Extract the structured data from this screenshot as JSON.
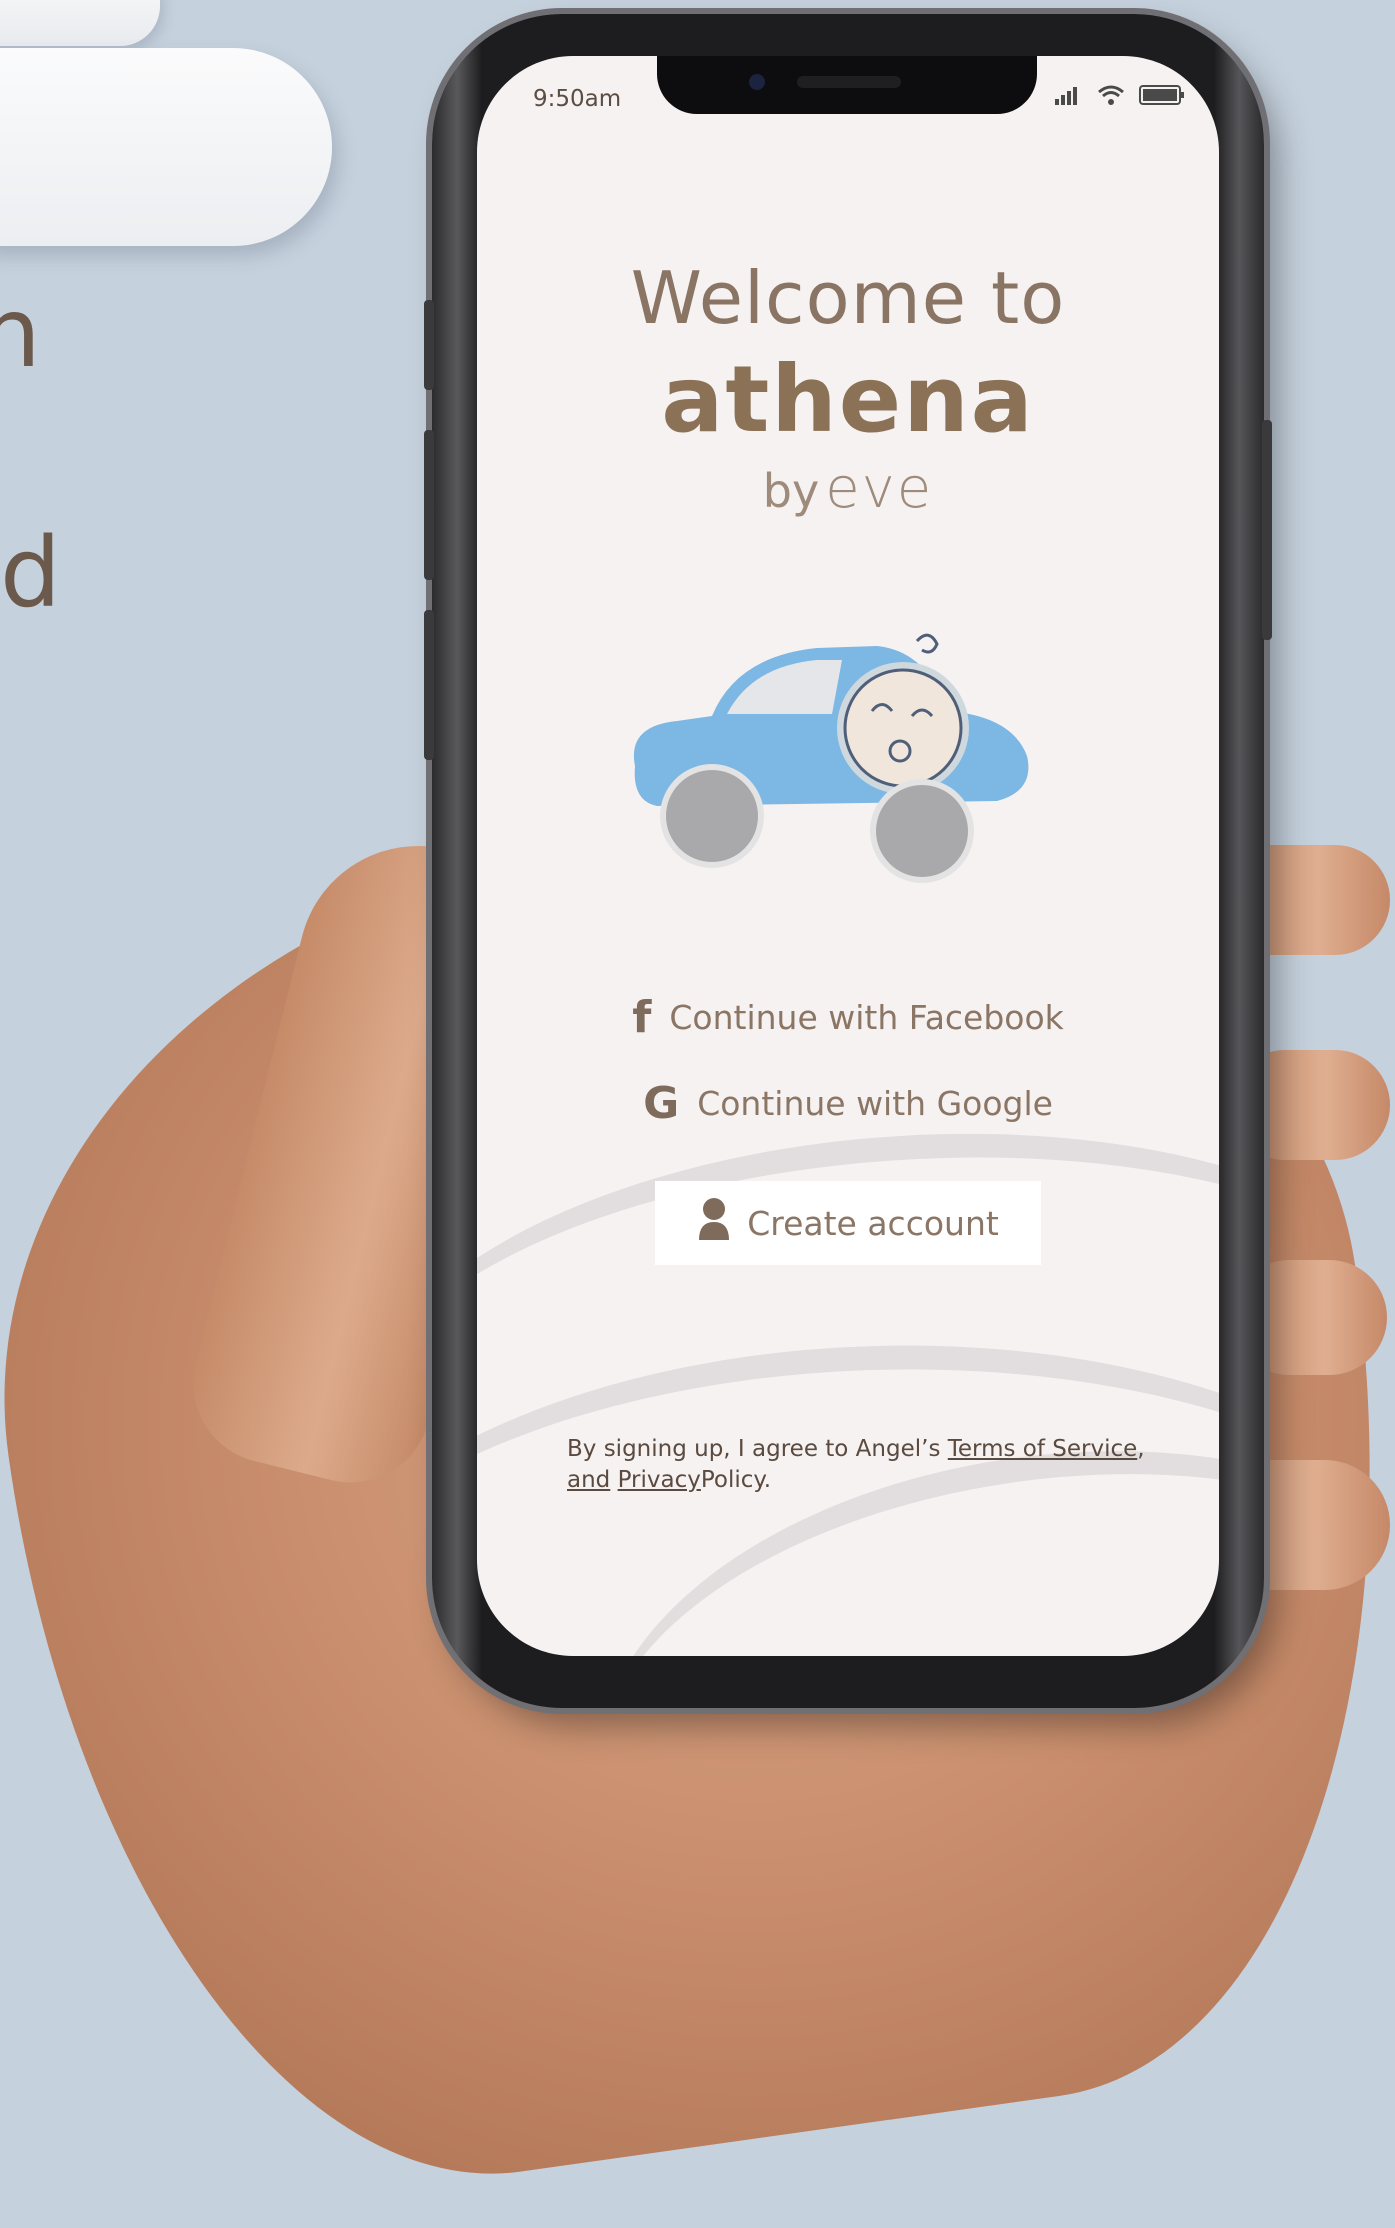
{
  "background": {
    "letters": [
      "n",
      "d"
    ]
  },
  "status_bar": {
    "time": "9:50am"
  },
  "welcome": {
    "line1": "Welcome to",
    "brand": "athena",
    "by": "by",
    "eve": "eve"
  },
  "auth": {
    "facebook_label": "Continue with Facebook",
    "google_label": "Continue with Google",
    "create_account_label": "Create account"
  },
  "terms": {
    "prefix": "By signing up, I agree to Angel’s ",
    "terms_link": "Terms of Service",
    "comma": ",",
    "and": "and",
    "privacy_link": "Privacy",
    "policy": "Policy",
    "period": "."
  },
  "icons": {
    "facebook": "facebook-icon",
    "google": "google-icon",
    "user": "user-icon",
    "signal": "signal-icon",
    "wifi": "wifi-icon",
    "battery": "battery-icon"
  },
  "colors": {
    "background": "#c5d1dd",
    "screen": "#f6f2f1",
    "text_brown": "#8b7256",
    "button_bg": "#ffffff",
    "car_blue": "#7db7e4"
  }
}
